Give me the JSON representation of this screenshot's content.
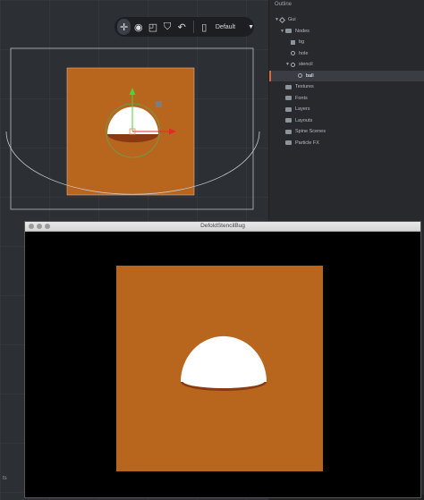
{
  "toolbar": {
    "tools": [
      {
        "name": "move-tool",
        "icon": "move-icon",
        "active": true
      },
      {
        "name": "rotate-tool",
        "icon": "rotate-icon",
        "active": false
      },
      {
        "name": "scale-tool",
        "icon": "scale-icon",
        "active": false
      },
      {
        "name": "visibility-filter",
        "icon": "eye-icon",
        "active": false
      },
      {
        "name": "reset-camera",
        "icon": "undo-icon",
        "active": false
      }
    ],
    "layout_label": "Default"
  },
  "outline": {
    "title": "Outline",
    "items": [
      {
        "label": "Gui",
        "depth": 0,
        "icon": "gui-icon",
        "expanded": true,
        "selected": false
      },
      {
        "label": "Nodes",
        "depth": 1,
        "icon": "folder-icon",
        "expanded": true,
        "selected": false
      },
      {
        "label": "bg",
        "depth": 2,
        "icon": "box-node-icon",
        "expanded": null,
        "selected": false
      },
      {
        "label": "hole",
        "depth": 2,
        "icon": "stencil-icon",
        "expanded": null,
        "selected": false
      },
      {
        "label": "stencil",
        "depth": 2,
        "icon": "stencil-icon",
        "expanded": true,
        "selected": false
      },
      {
        "label": "ball",
        "depth": 3,
        "icon": "stencil-icon",
        "expanded": null,
        "selected": true
      },
      {
        "label": "Textures",
        "depth": 1,
        "icon": "folder-icon",
        "expanded": null,
        "selected": false
      },
      {
        "label": "Fonts",
        "depth": 1,
        "icon": "folder-icon",
        "expanded": null,
        "selected": false
      },
      {
        "label": "Layers",
        "depth": 1,
        "icon": "folder-icon",
        "expanded": null,
        "selected": false
      },
      {
        "label": "Layouts",
        "depth": 1,
        "icon": "folder-icon",
        "expanded": null,
        "selected": false
      },
      {
        "label": "Spine Scenes",
        "depth": 1,
        "icon": "folder-icon",
        "expanded": null,
        "selected": false
      },
      {
        "label": "Particle FX",
        "depth": 1,
        "icon": "folder-icon",
        "expanded": null,
        "selected": false
      }
    ]
  },
  "game_window": {
    "title": "DefoldStencilBug"
  },
  "colors": {
    "bg_orange": "#b8651e",
    "ball_white": "#ffffff",
    "ball_rim": "#8a3a12",
    "selection_accent": "#e0663a"
  }
}
